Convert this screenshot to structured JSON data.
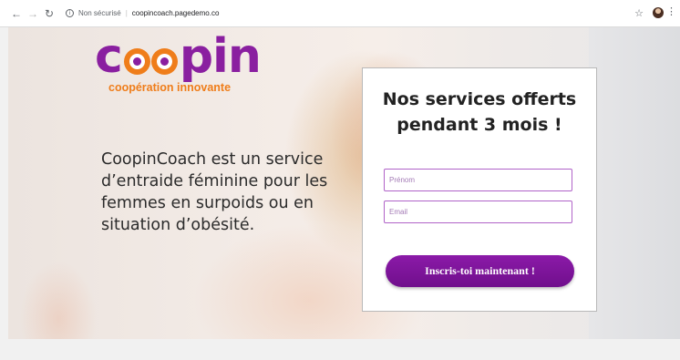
{
  "browser": {
    "security_label": "Non sécurisé",
    "separator": "|",
    "url": "coopincoach.pagedemo.co",
    "icons": [
      "back-arrow-icon",
      "forward-arrow-icon",
      "reload-icon",
      "info-icon",
      "star-icon",
      "profile-avatar-icon",
      "kebab-menu-icon"
    ]
  },
  "logo": {
    "prefix": "c",
    "suffix": "pin",
    "tagline": "coopération innovante",
    "colors": {
      "purple": "#8a1fa0",
      "orange": "#ef7d1a"
    }
  },
  "hero": {
    "description": "CoopinCoach est un service d’entraide féminine pour les femmes en surpoids ou en situation d’obésité."
  },
  "form": {
    "title": "Nos services offerts pendant 3 mois !",
    "firstname_placeholder": "Prénom",
    "email_placeholder": "Email",
    "submit_label": "Inscris-toi maintenant !",
    "accent": "#8b1aa8"
  }
}
